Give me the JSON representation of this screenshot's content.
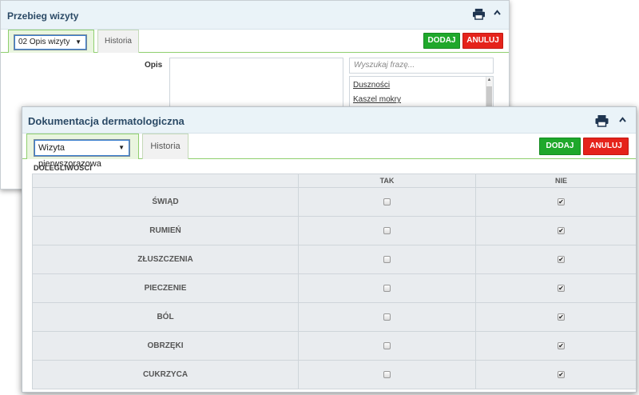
{
  "back_panel": {
    "title": "Przebieg wizyty",
    "select_value": "02 Opis wizyty",
    "tab_history": "Historia",
    "add_label": "DODAJ",
    "cancel_label": "ANULUJ",
    "opis_label": "Opis",
    "search_placeholder": "Wyszukaj frazę...",
    "list_items": [
      "Duszności",
      "Kaszel mokry"
    ]
  },
  "front_panel": {
    "title": "Dokumentacja dermatologiczna",
    "select_value": "Wizyta pierwszorazowa",
    "tab_history": "Historia",
    "add_label": "DODAJ",
    "cancel_label": "ANULUJ",
    "section_label": "DOLEGLIWOŚCI",
    "columns": [
      "TAK",
      "NIE"
    ],
    "rows": [
      {
        "label": "ŚWIĄD",
        "tak": false,
        "nie": true
      },
      {
        "label": "RUMIEŃ",
        "tak": false,
        "nie": true
      },
      {
        "label": "ZŁUSZCZENIA",
        "tak": false,
        "nie": true
      },
      {
        "label": "PIECZENIE",
        "tak": false,
        "nie": true
      },
      {
        "label": "BÓL",
        "tak": false,
        "nie": true
      },
      {
        "label": "OBRZĘKI",
        "tak": false,
        "nie": true
      },
      {
        "label": "CUKRZYCA",
        "tak": false,
        "nie": true
      }
    ]
  },
  "icons": {
    "print": "printer-icon",
    "collapse": "chevron-up-icon",
    "dropdown": "caret-down-icon"
  },
  "colors": {
    "accent_green": "#1fa82b",
    "accent_red": "#e5231b",
    "title_blue": "#2b4a66",
    "tab_border": "#8fcf6e"
  }
}
